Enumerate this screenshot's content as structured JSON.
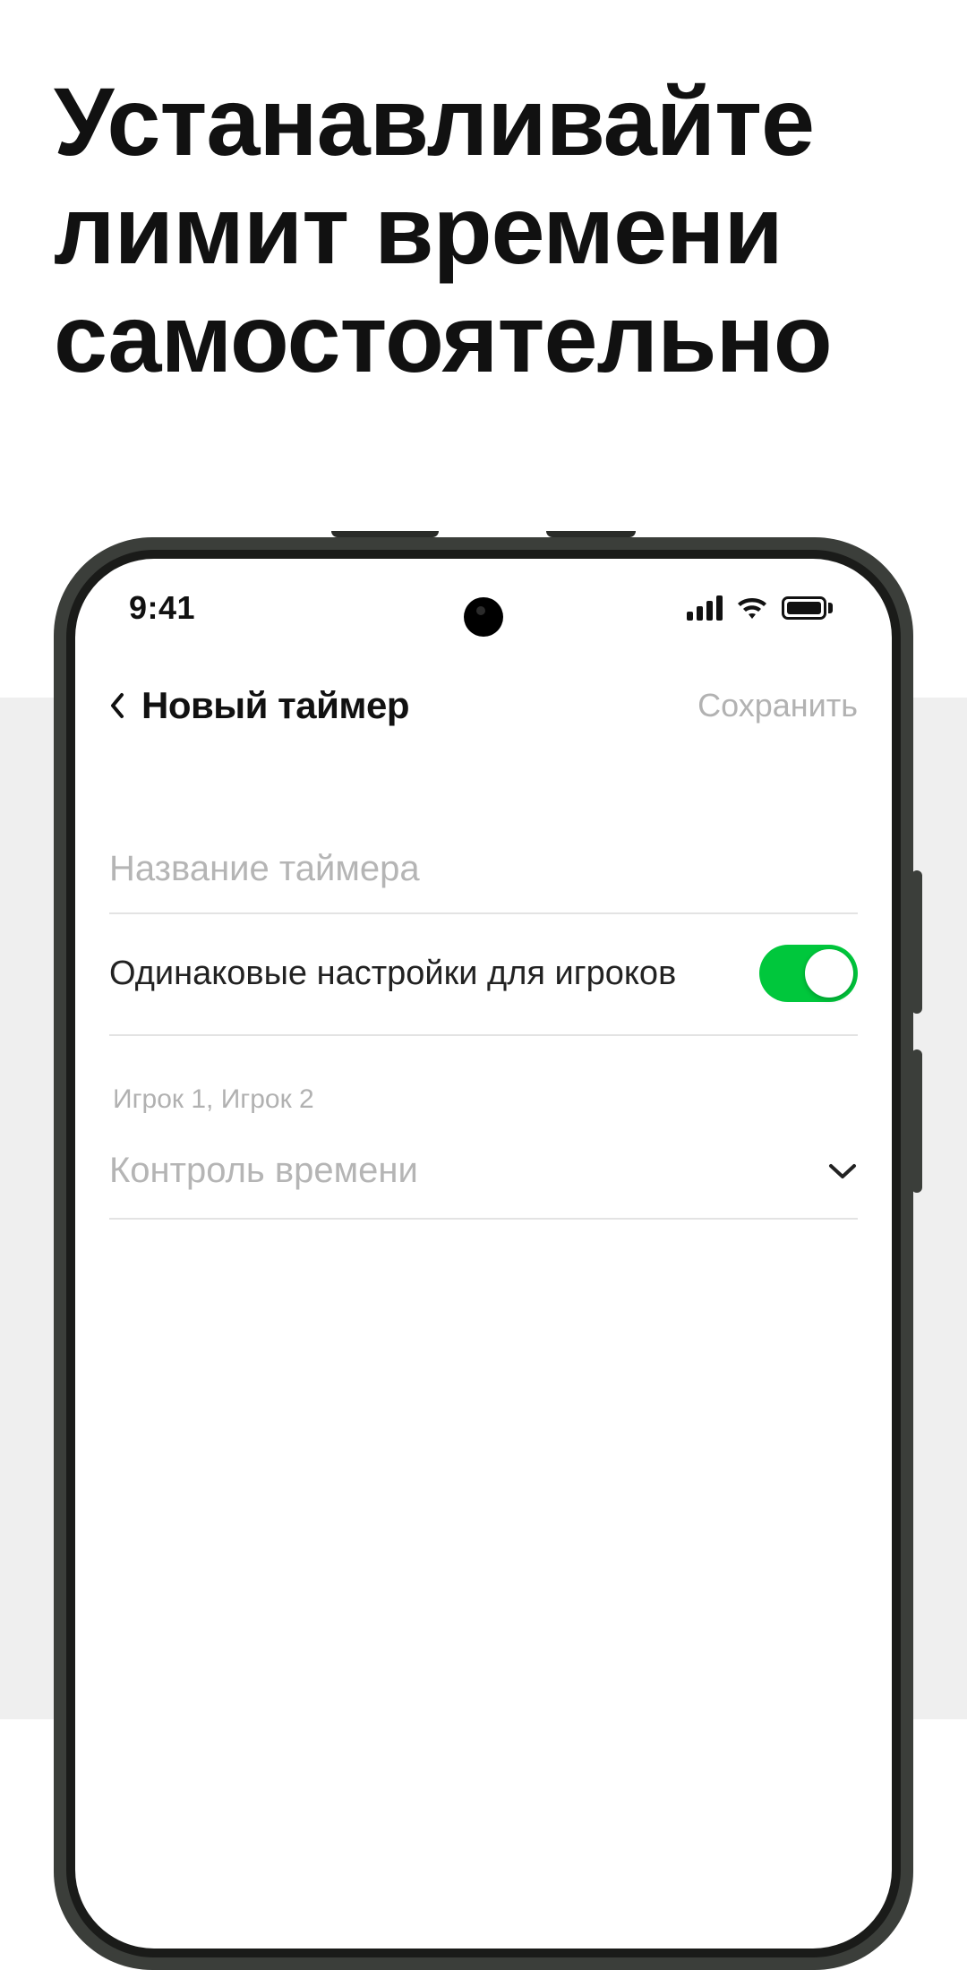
{
  "hero": {
    "title": "Устанавливайте лимит времени самостоятельно"
  },
  "status": {
    "time": "9:41"
  },
  "header": {
    "title": "Новый таймер",
    "save_label": "Сохранить"
  },
  "form": {
    "name_placeholder": "Название таймера",
    "same_settings_label": "Одинаковые настройки для игроков",
    "same_settings_on": true,
    "players_caption": "Игрок 1, Игрок 2",
    "time_control_label": "Контроль времени"
  },
  "colors": {
    "toggle_on": "#00c73c"
  }
}
